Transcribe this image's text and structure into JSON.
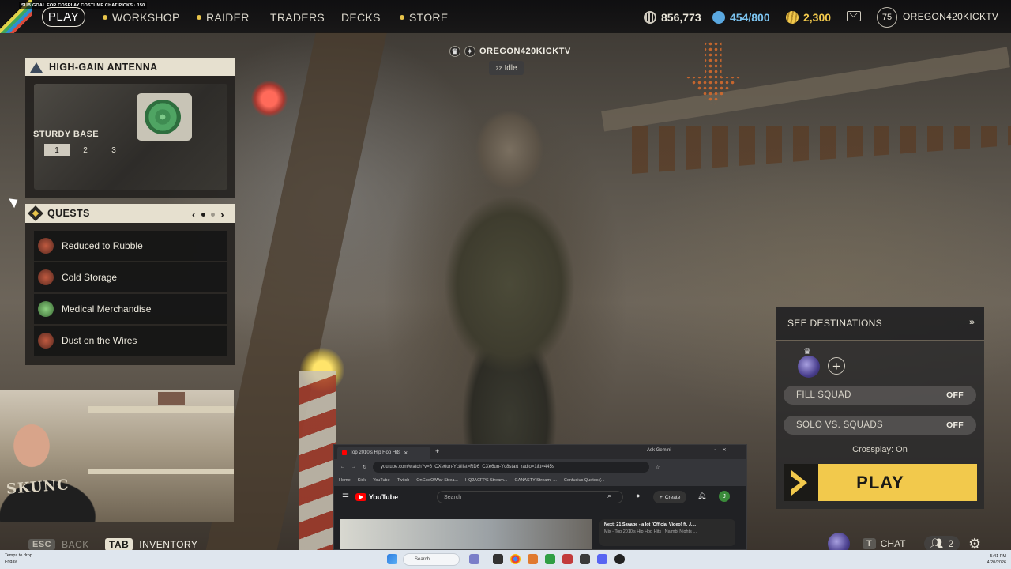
{
  "overlay": {
    "sub_goal": "SUB GOAL FOR COSPLAY COSTUME CHAT PICKS · 150"
  },
  "nav": {
    "play": "PLAY",
    "items": [
      {
        "label": "WORKSHOP",
        "dot": true
      },
      {
        "label": "RAIDER",
        "dot": true
      },
      {
        "label": "TRADERS",
        "dot": false
      },
      {
        "label": "DECKS",
        "dot": false
      },
      {
        "label": "STORE",
        "dot": true
      }
    ]
  },
  "currencies": {
    "coins": "856,773",
    "tokens": "454/800",
    "credits": "2,300"
  },
  "profile": {
    "level": "75",
    "username": "OREGON420KICKTV"
  },
  "player_tag": {
    "name": "OREGON420KICKTV",
    "status": "Idle"
  },
  "antenna_card": {
    "title": "HIGH-GAIN ANTENNA",
    "subtitle": "STURDY BASE",
    "tiers": [
      "1",
      "2",
      "3"
    ],
    "active_tier": "1"
  },
  "quests": {
    "title": "QUESTS",
    "prev": "‹",
    "next": "›",
    "items": [
      {
        "name": "Reduced to Rubble",
        "icon_color": "#8a3a2a"
      },
      {
        "name": "Cold Storage",
        "icon_color": "#8a3a2a"
      },
      {
        "name": "Medical Merchandise",
        "icon_color": "#4f8a4a"
      },
      {
        "name": "Dust on the Wires",
        "icon_color": "#8a3a2a"
      }
    ]
  },
  "webcam": {
    "logo_text": "SKUNC"
  },
  "hints": {
    "back_key": "ESC",
    "back_label": "BACK",
    "inventory_key": "TAB",
    "inventory_label": "INVENTORY"
  },
  "browser": {
    "tab_title": "Top 2010's Hip Hop Hits",
    "gemini": "Ask Gemini",
    "url": "youtube.com/watch?v=6_CXe6un-Yc8list=RD6_CXe6un-Yc8start_radio=1&t=445s",
    "bookmarks": [
      "Home",
      "Kick",
      "YouTube",
      "Twitch",
      "OnGodOfWar Strea...",
      "HQ2ACFPS Stream...",
      "GANASTY Stream -...",
      "Confucius Quotes (..."
    ],
    "yt_logo": "YouTube",
    "search_placeholder": "Search",
    "create_label": "Create",
    "user_initial": "J",
    "next_label": "Next: 21 Savage - a lot (Official Video) ft. J....",
    "next_sub": "Mix - Top 2010's Hip Hop Hits | Naimbi Nights ..."
  },
  "right_panel": {
    "destinations": "SEE DESTINATIONS",
    "fill_squad_label": "FILL SQUAD",
    "fill_squad_value": "OFF",
    "solo_label": "SOLO VS. SQUADS",
    "solo_value": "OFF",
    "crossplay": "Crossplay: On",
    "play": "PLAY",
    "chat_key": "T",
    "chat_label": "CHAT",
    "friends_count": "2"
  },
  "taskbar": {
    "weather_line1": "Temps to drop",
    "weather_line2": "Friday",
    "search": "Search",
    "time": "5:41 PM",
    "date": "4/20/2026"
  },
  "colors": {
    "accent_yellow": "#f2c94c",
    "panel_header": "#e6e0cf",
    "panel_bg": "#22201e"
  }
}
